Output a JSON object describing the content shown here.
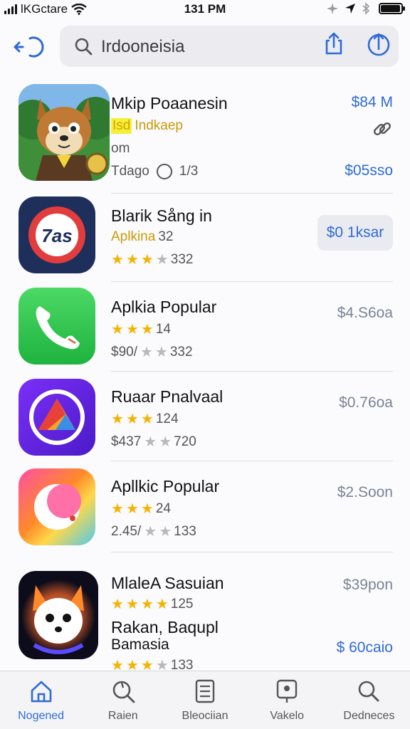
{
  "status_bar": {
    "carrier": "lKGctare",
    "time": "131 PM"
  },
  "search": {
    "query": "Irdooneisia",
    "icons": [
      "back-icon",
      "search-icon",
      "share-icon",
      "upload-icon"
    ]
  },
  "apps": [
    {
      "name": "Mkip Poaanesin",
      "line2_highlight": "Isd",
      "line2_text": "Indkaep",
      "line3": "om",
      "line4": "Tdago",
      "line4_count": "1/3",
      "price": "$84 M",
      "price2": "$05sso",
      "icon": "fox-mascot-icon"
    },
    {
      "name": "Blarik Sång in",
      "category": "Aplkina",
      "category_num": "32",
      "rating": 3,
      "rating_count": "332",
      "button": "$0 1ksar",
      "icon": "badge-icon",
      "badge_text": "7as"
    },
    {
      "name": "Aplkia Popular",
      "rating": 3,
      "rating_count": "14",
      "price_line": "$90/",
      "rating2": 2,
      "rating2_count": "332",
      "price": "$4.S6oa",
      "icon": "phone-icon"
    },
    {
      "name": "Ruaar Pnalvaal",
      "rating": 3,
      "rating_count": "124",
      "price_line": "$437",
      "rating2": 2,
      "rating2_count": "720",
      "price": "$0.76oa",
      "icon": "triangle-icon"
    },
    {
      "name": "Apllkic Popular",
      "rating": 3,
      "rating_count": "24",
      "price_line": "2.45/",
      "rating2": 2,
      "rating2_count": "133",
      "price": "$2.Soon",
      "icon": "crescent-icon"
    },
    {
      "name": "MlaleA Sasuian",
      "rating": 4,
      "rating_count": "125",
      "name2_line1": "Rakan, Baqupl",
      "name2_line2": "Bamasia",
      "rating2": 3,
      "rating2_count": "133",
      "price": "$39pon",
      "price2": "$ 60caio",
      "icon": "fox-glow-icon"
    }
  ],
  "tabs": [
    {
      "label": "Nogened",
      "icon": "home-icon",
      "active": true
    },
    {
      "label": "Raien",
      "icon": "search-tab-icon",
      "active": false
    },
    {
      "label": "Bleociian",
      "icon": "list-icon",
      "active": false
    },
    {
      "label": "Vakelo",
      "icon": "pin-icon",
      "active": false
    },
    {
      "label": "Dedneces",
      "icon": "magnifier-icon",
      "active": false
    }
  ],
  "colors": {
    "accent": "#2f6bd8",
    "star": "#f5b301",
    "divider": "#dcdce1"
  }
}
